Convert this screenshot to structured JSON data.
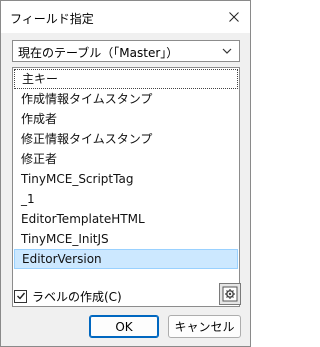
{
  "window": {
    "title": "フィールド指定"
  },
  "table_select": {
    "value": "現在のテーブル（「Master」）"
  },
  "fields": [
    "主キー",
    "作成情報タイムスタンプ",
    "作成者",
    "修正情報タイムスタンプ",
    "修正者",
    "TinyMCE_ScriptTag",
    "_1",
    "EditorTemplateHTML",
    "TinyMCE_InitJS",
    "EditorVersion"
  ],
  "create_label": {
    "label": "ラベルの作成(C)",
    "checked": true
  },
  "buttons": {
    "ok": "OK",
    "cancel": "キャンセル"
  },
  "colors": {
    "selection": "#cce8ff",
    "default_button_border": "#0067c0"
  }
}
